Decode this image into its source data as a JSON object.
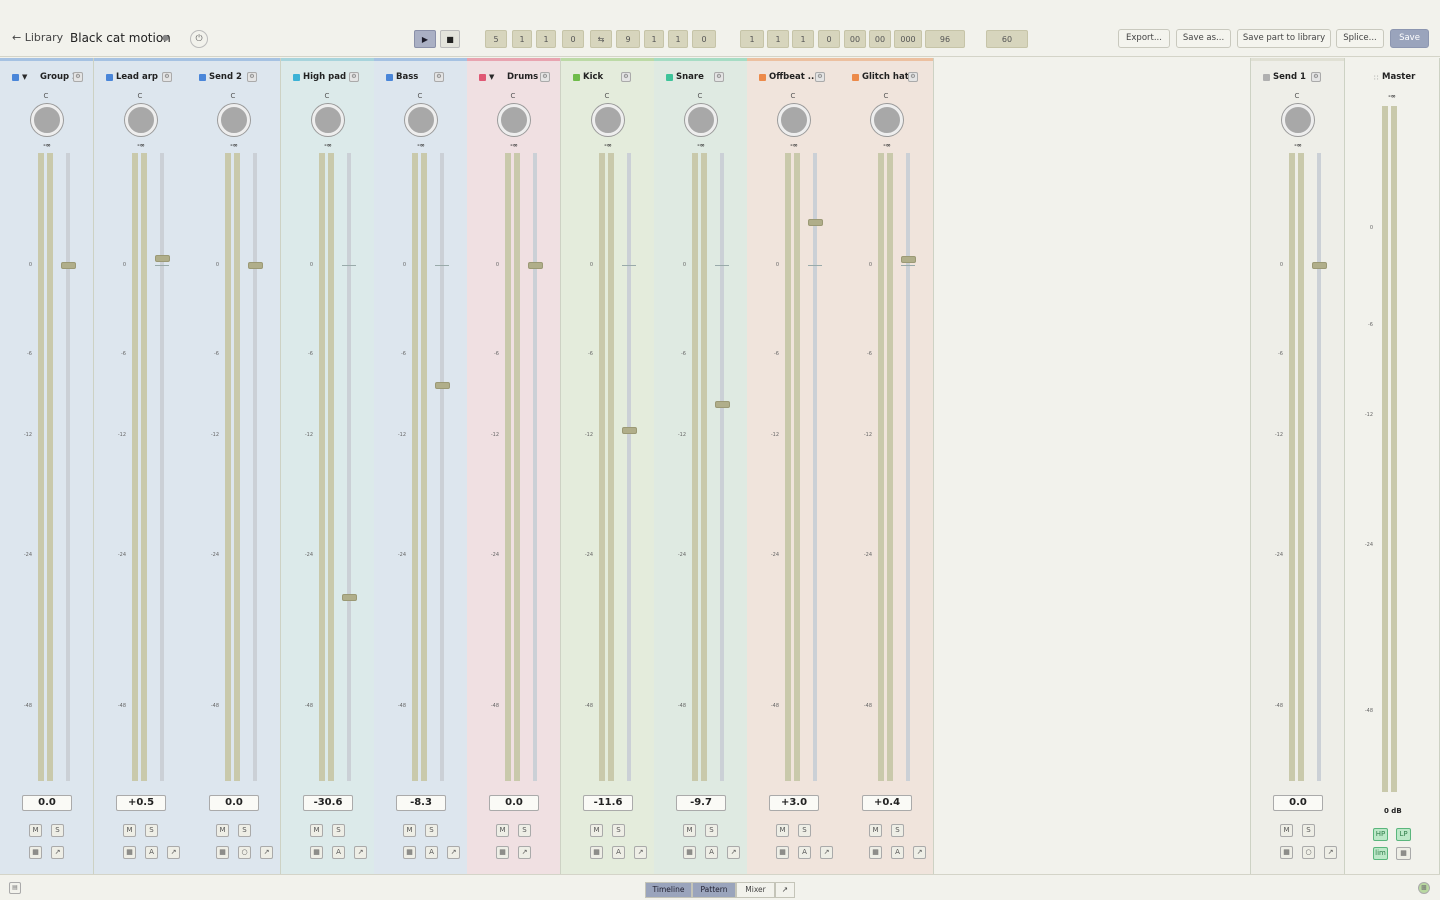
{
  "header": {
    "back_label": "Library",
    "song_title": "Black cat motion",
    "position_cells": [
      "5",
      "1",
      "1",
      "0"
    ],
    "loop_cells": [
      "9",
      "1",
      "1",
      "0"
    ],
    "time_cells": [
      "1",
      "1",
      "1",
      "0",
      "00",
      "00",
      "000",
      "96"
    ],
    "tempo": "60",
    "actions": [
      "Export...",
      "Save as...",
      "Save part to library",
      "Splice...",
      "Save"
    ]
  },
  "strips": [
    {
      "name": "Group 2",
      "group": true,
      "pan": "C",
      "value": "0.0",
      "fader_db": 0,
      "buttons": [
        "M",
        "S"
      ],
      "icons": [
        "▦",
        "↗"
      ],
      "swatch": "#4a86d9",
      "bg": "#dde6ee",
      "top": "#a6c2e2"
    },
    {
      "name": "Lead arp",
      "group": false,
      "pan": "C",
      "value": "+0.5",
      "fader_db": 0.5,
      "buttons": [
        "M",
        "S"
      ],
      "icons": [
        "▦",
        "A",
        "↗"
      ],
      "swatch": "#4a86d9",
      "bg": "#dde6ee",
      "top": "#a6c2e2"
    },
    {
      "name": "Send 2",
      "group": false,
      "pan": "C",
      "value": "0.0",
      "fader_db": 0,
      "buttons": [
        "M",
        "S"
      ],
      "icons": [
        "▦",
        "○",
        "↗"
      ],
      "swatch": "#4a86d9",
      "bg": "#dde6ee",
      "top": "#a6c2e2"
    },
    {
      "name": "High pad",
      "group": false,
      "pan": "C",
      "value": "-30.6",
      "fader_db": -30.6,
      "buttons": [
        "M",
        "S"
      ],
      "icons": [
        "▦",
        "A",
        "↗"
      ],
      "swatch": "#3bb2d6",
      "bg": "#dceaea",
      "top": "#a8d4dc"
    },
    {
      "name": "Bass",
      "group": false,
      "pan": "C",
      "value": "-8.3",
      "fader_db": -8.3,
      "buttons": [
        "M",
        "S"
      ],
      "icons": [
        "▦",
        "A",
        "↗"
      ],
      "swatch": "#4a86d9",
      "bg": "#dde6ee",
      "top": "#a6c2e2"
    },
    {
      "name": "Drums",
      "group": true,
      "pan": "C",
      "value": "0.0",
      "fader_db": 0,
      "buttons": [
        "M",
        "S"
      ],
      "icons": [
        "▦",
        "↗"
      ],
      "swatch": "#e05874",
      "bg": "#f0e0e2",
      "top": "#e8a4b0"
    },
    {
      "name": "Kick",
      "group": false,
      "pan": "C",
      "value": "-11.6",
      "fader_db": -11.6,
      "buttons": [
        "M",
        "S"
      ],
      "icons": [
        "▦",
        "A",
        "↗"
      ],
      "swatch": "#6ebc4a",
      "bg": "#e4ecdc",
      "top": "#bcdaa6"
    },
    {
      "name": "Snare",
      "group": false,
      "pan": "C",
      "value": "-9.7",
      "fader_db": -9.7,
      "buttons": [
        "M",
        "S"
      ],
      "icons": [
        "▦",
        "A",
        "↗"
      ],
      "swatch": "#3ec49a",
      "bg": "#dfeae2",
      "top": "#a6dcc4"
    },
    {
      "name": "Offbeat ...",
      "group": false,
      "pan": "C",
      "value": "+3.0",
      "fader_db": 3,
      "buttons": [
        "M",
        "S"
      ],
      "icons": [
        "▦",
        "A",
        "↗"
      ],
      "swatch": "#ec8a4a",
      "bg": "#f0e4dc",
      "top": "#ecc0a0"
    },
    {
      "name": "Glitch hat",
      "group": false,
      "pan": "C",
      "value": "+0.4",
      "fader_db": 0.4,
      "buttons": [
        "M",
        "S"
      ],
      "icons": [
        "▦",
        "A",
        "↗"
      ],
      "swatch": "#ec8a4a",
      "bg": "#f0e4dc",
      "top": "#ecc0a0"
    },
    {
      "name": "Send 1",
      "group": false,
      "pan": "C",
      "value": "0.0",
      "fader_db": 0,
      "buttons": [
        "M",
        "S"
      ],
      "icons": [
        "▦",
        "○",
        "↗"
      ],
      "swatch": "#b0b0b0",
      "bg": "#eeeee8",
      "top": "#e0e0d4"
    }
  ],
  "scale_ticks": [
    "0",
    "-6",
    "-12",
    "-24",
    "-48"
  ],
  "neg_inf": "-∞",
  "master": {
    "name": "Master",
    "neg_inf": "-∞",
    "value": "0 dB",
    "buttons": [
      "HP",
      "LP",
      "lim",
      "▦"
    ],
    "ticks": [
      "0",
      "-6",
      "-12",
      "-24",
      "-48"
    ]
  },
  "footer": {
    "tabs": [
      "Timeline",
      "Pattern",
      "Mixer"
    ],
    "active": [
      "Timeline",
      "Pattern"
    ]
  },
  "colors": {
    "accent": "#9aa4bc",
    "meter": "#c9c9ab"
  }
}
